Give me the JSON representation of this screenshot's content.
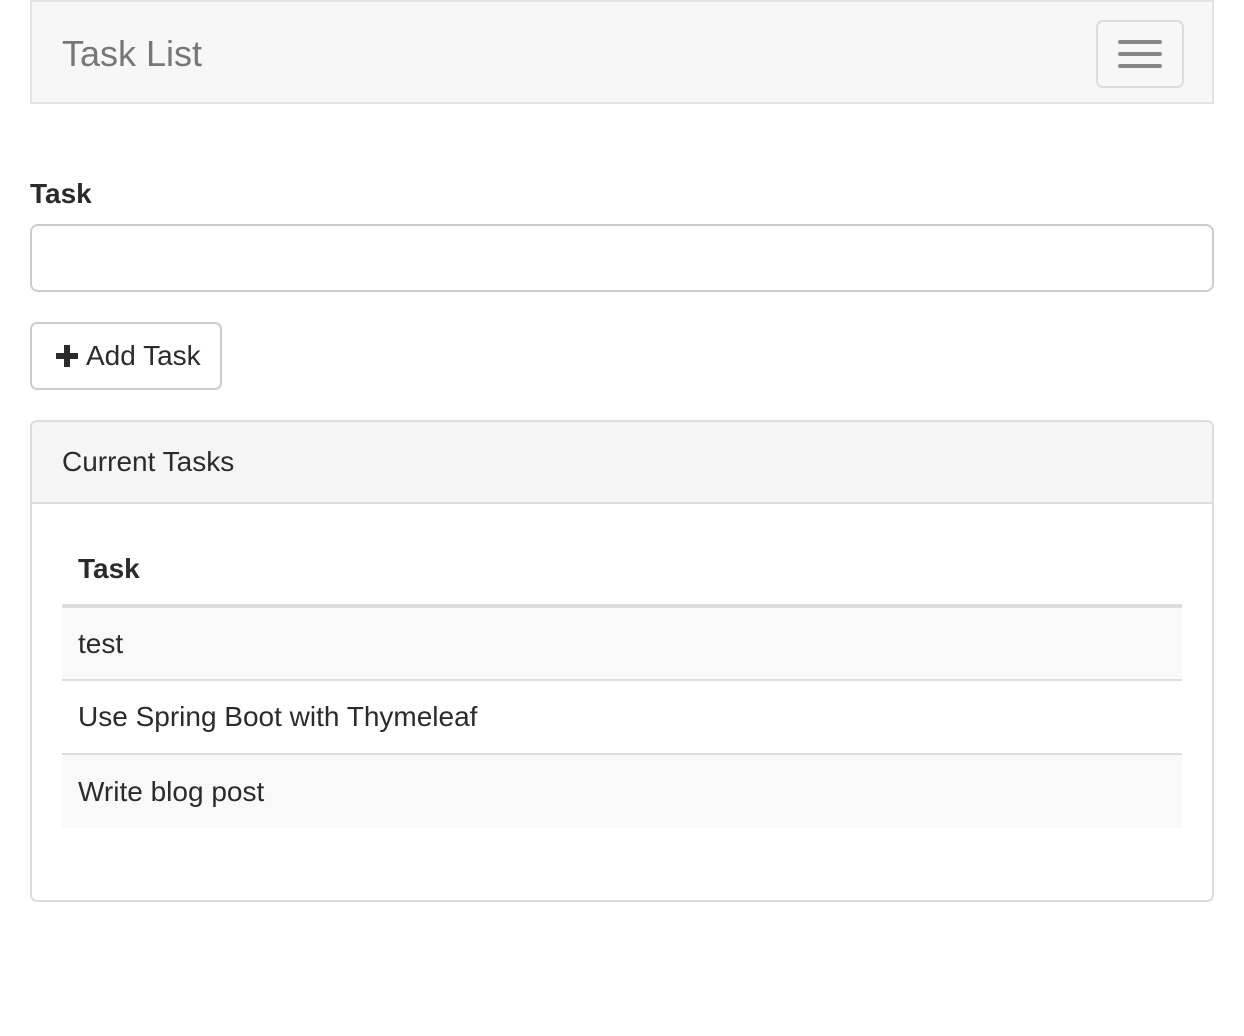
{
  "navbar": {
    "brand": "Task List",
    "toggle_icon": "hamburger-menu-icon"
  },
  "form": {
    "task_label": "Task",
    "task_input_value": "",
    "task_input_placeholder": "",
    "add_button_icon": "plus-icon",
    "add_button_label": "Add Task"
  },
  "panel": {
    "title": "Current Tasks",
    "table": {
      "columns": [
        "Task"
      ],
      "rows": [
        {
          "task": "test"
        },
        {
          "task": "Use Spring Boot with Thymeleaf"
        },
        {
          "task": "Write blog post"
        }
      ]
    }
  },
  "colors": {
    "navbar_bg": "#f7f7f7",
    "brand_text": "#777777",
    "panel_heading_bg": "#f5f5f5",
    "striped_row_bg": "#f9f9f9",
    "border": "#dddddd"
  }
}
